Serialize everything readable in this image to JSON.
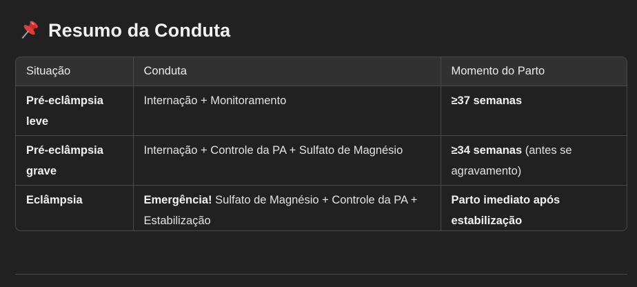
{
  "section": {
    "title": "Resumo da Conduta",
    "icon": "pushpin-icon"
  },
  "table": {
    "headers": [
      "Situação",
      "Conduta",
      "Momento do Parto"
    ],
    "rows": [
      {
        "situation": "Pré-eclâmpsia leve",
        "conduct_bold": "",
        "conduct": "Internação + Monitoramento",
        "timing_bold": "≥37 semanas",
        "timing": ""
      },
      {
        "situation": "Pré-eclâmpsia grave",
        "conduct_bold": "",
        "conduct": "Internação + Controle da PA + Sulfato de Magnésio",
        "timing_bold": "≥34 semanas",
        "timing": " (antes se agravamento)"
      },
      {
        "situation": "Eclâmpsia",
        "conduct_bold": "Emergência!",
        "conduct": " Sulfato de Magnésio + Controle da PA + Estabilização",
        "timing_bold": "Parto imediato após estabilização",
        "timing": ""
      }
    ]
  },
  "colors": {
    "background": "#212121",
    "header_row": "#313131",
    "border": "#4a4a4a",
    "pin_red": "#e23b3b"
  }
}
